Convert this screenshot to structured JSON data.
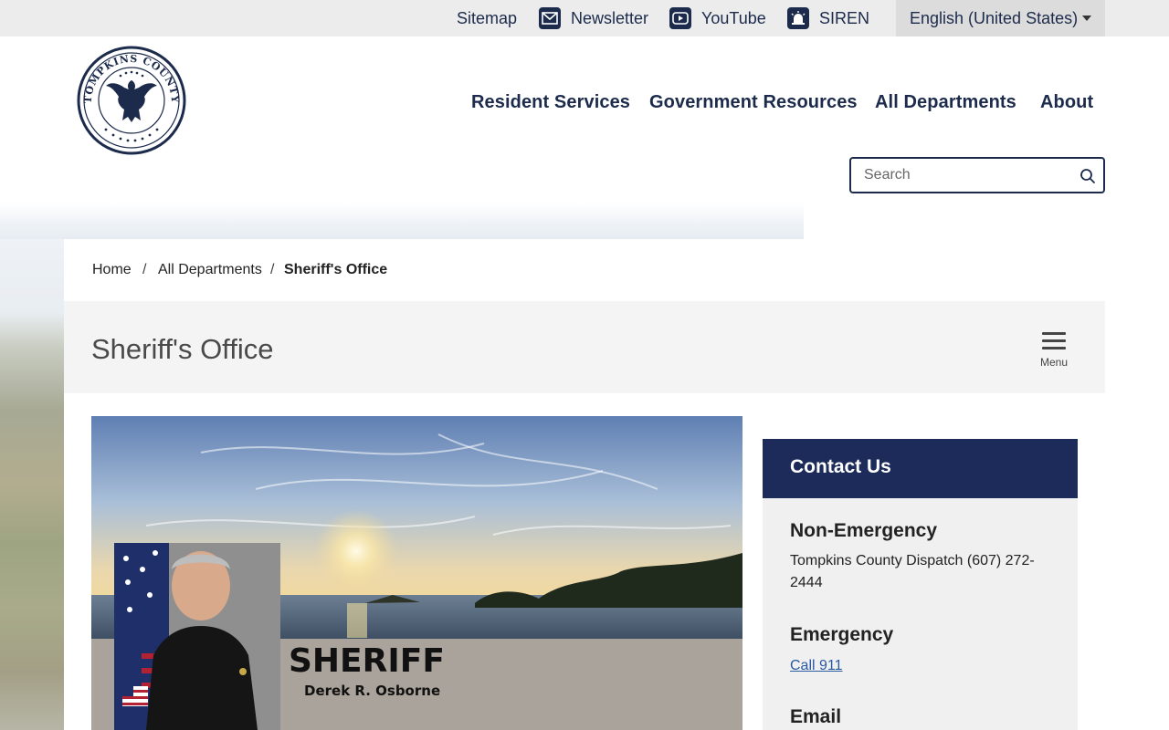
{
  "utility": {
    "sitemap": "Sitemap",
    "newsletter": "Newsletter",
    "youtube": "YouTube",
    "siren": "SIREN",
    "language": "English (United States)"
  },
  "logo": {
    "ring_text": "TOMPKINS COUNTY"
  },
  "nav": {
    "items": [
      "Resident Services",
      "Government Resources",
      "All Departments",
      "About"
    ]
  },
  "search": {
    "placeholder": "Search"
  },
  "breadcrumb": {
    "home": "Home",
    "departments": "All Departments",
    "current": "Sheriff's Office",
    "separator": "/"
  },
  "page": {
    "title": "Sheriff's Office",
    "menu_label": "Menu"
  },
  "hero": {
    "heading": "SHERIFF",
    "name": "Derek R. Osborne"
  },
  "contact": {
    "title": "Contact Us",
    "non_emergency_heading": "Non-Emergency",
    "non_emergency_text_line1": "Tompkins County Dispatch (607) 272-",
    "non_emergency_text_line2": "2444",
    "emergency_heading": "Emergency",
    "emergency_link": "Call 911",
    "email_heading": "Email"
  },
  "colors": {
    "navy": "#1c2b4c",
    "contact_header": "#1c2b5a",
    "link": "#2a5aa0"
  },
  "icons": [
    "envelope-icon",
    "youtube-play-icon",
    "siren-light-icon",
    "caret-down-icon",
    "magnifier-icon",
    "hamburger-icon",
    "county-seal-logo"
  ]
}
